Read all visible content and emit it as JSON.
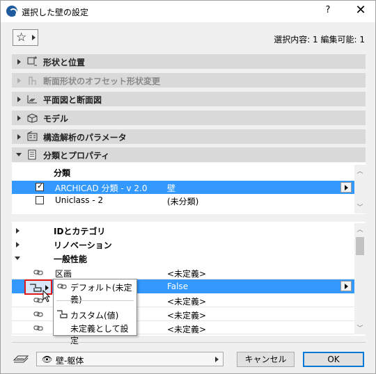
{
  "window": {
    "title": "選択した壁の設定",
    "help": "?",
    "close": "✕"
  },
  "toolbar": {
    "star": "☆",
    "selection_info": "選択内容: 1 編集可能: 1"
  },
  "sections": [
    {
      "label": "形状と位置",
      "icon": "geometry-icon",
      "disabled": false,
      "expanded": false
    },
    {
      "label": "断面形状のオフセット形状変更",
      "icon": "profile-offset-icon",
      "disabled": true,
      "expanded": false
    },
    {
      "label": "平面図と断面図",
      "icon": "floor-plan-icon",
      "disabled": false,
      "expanded": false
    },
    {
      "label": "モデル",
      "icon": "model-icon",
      "disabled": false,
      "expanded": false
    },
    {
      "label": "構造解析のパラメータ",
      "icon": "structural-analysis-icon",
      "disabled": false,
      "expanded": false
    },
    {
      "label": "分類とプロパティ",
      "icon": "classification-icon",
      "disabled": false,
      "expanded": true
    }
  ],
  "classification": {
    "header": "分類",
    "rows": [
      {
        "checked": true,
        "name": "ARCHICAD 分類 - v 2.0",
        "value": "壁",
        "selected": true
      },
      {
        "checked": false,
        "name": "Uniclass - 2",
        "value": "(未分類)",
        "selected": false
      }
    ]
  },
  "properties": {
    "groups": [
      {
        "label": "IDとカテゴリ",
        "expanded": false
      },
      {
        "label": "リノベーション",
        "expanded": false
      },
      {
        "label": "一般性能",
        "expanded": true
      }
    ],
    "rows": [
      {
        "name": "区画",
        "value": "<未定義>",
        "selected": false
      },
      {
        "name": "",
        "value": "False",
        "selected": true
      },
      {
        "name": "",
        "value": "<未定義>",
        "selected": false
      },
      {
        "name": "",
        "value": "<未定義>",
        "selected": false
      },
      {
        "name": "",
        "value": "<未定義>",
        "selected": false
      },
      {
        "name": "",
        "value": "<未定義>",
        "selected": false
      }
    ]
  },
  "popup": {
    "items": [
      {
        "label": "デフォルト(未定義)",
        "icon": "link-icon",
        "selected": true
      },
      {
        "label": "カスタム(値)",
        "icon": "custom-value-icon",
        "selected": false
      },
      {
        "label": "未定義として設定",
        "icon": "",
        "selected": false
      }
    ]
  },
  "footer": {
    "layer": "壁-躯体",
    "cancel": "キャンセル",
    "ok": "OK"
  },
  "colors": {
    "selection": "#3399ff",
    "section_bg": "#d9d9d9",
    "highlight_border": "#e01818",
    "default_button_border": "#0078d7"
  }
}
